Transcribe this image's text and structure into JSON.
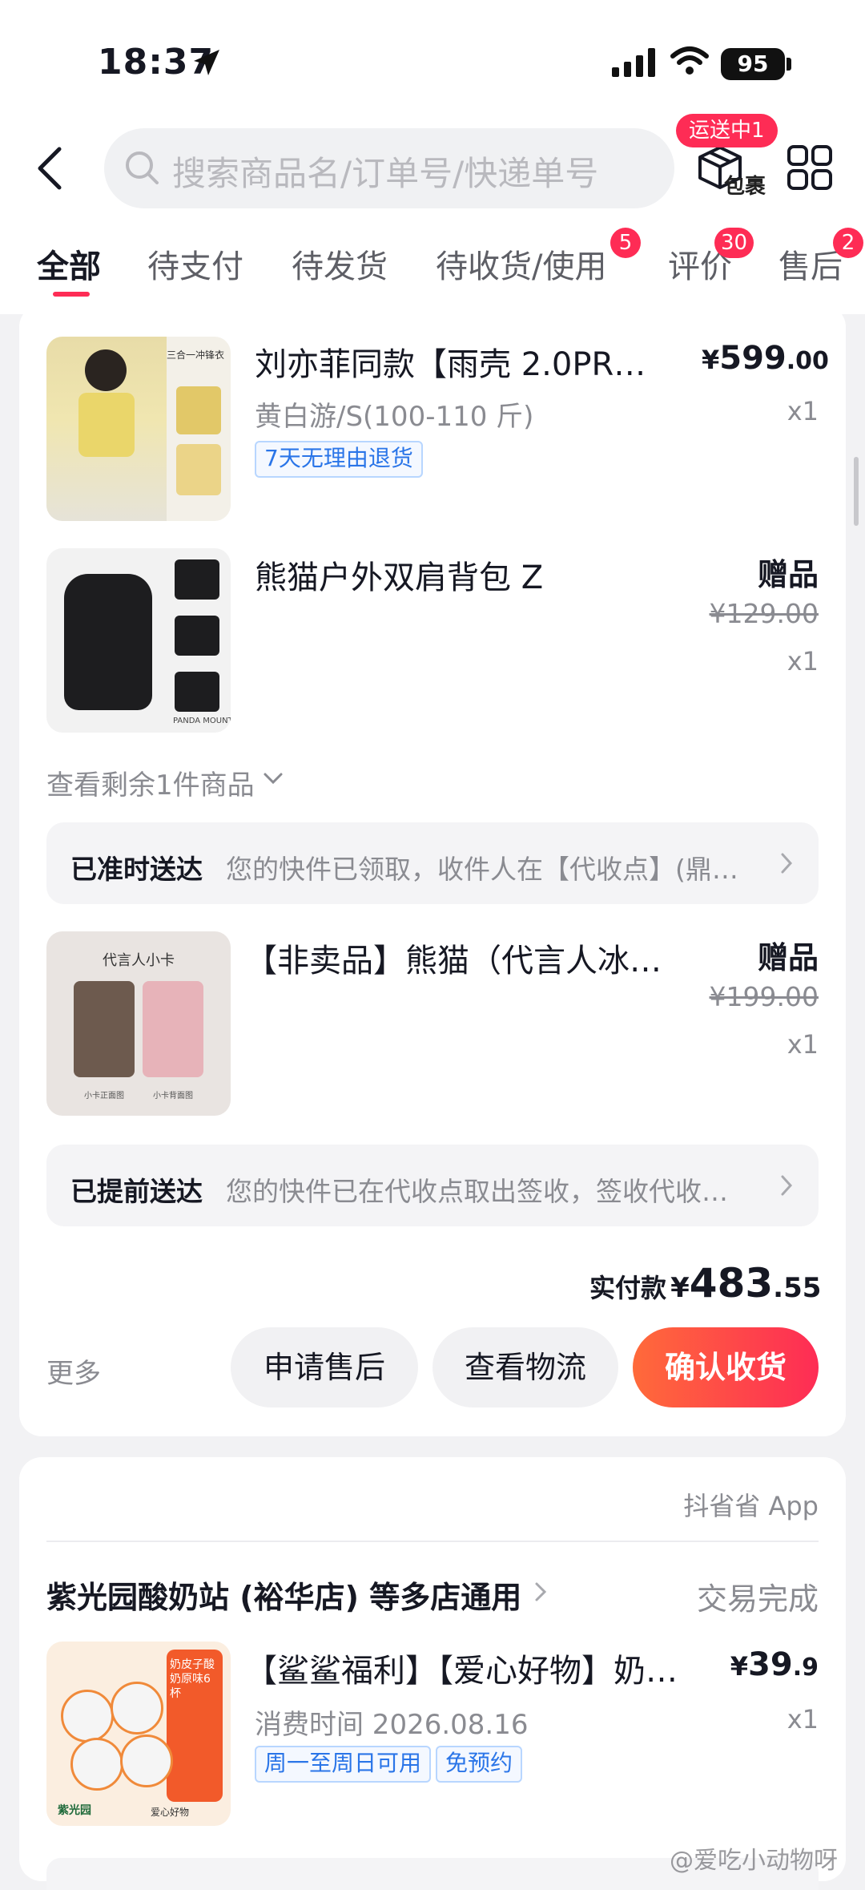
{
  "status_bar": {
    "time": "18:37",
    "battery": "95"
  },
  "header": {
    "search_placeholder": "搜索商品名/订单号/快递单号",
    "shipping_badge": "运送中1",
    "package_label": "包裹"
  },
  "tabs": [
    {
      "label": "全部",
      "active": true,
      "count": ""
    },
    {
      "label": "待支付",
      "count": ""
    },
    {
      "label": "待发货",
      "count": ""
    },
    {
      "label": "待收货/使用",
      "count": "5"
    },
    {
      "label": "评价",
      "count": "30"
    },
    {
      "label": "售后",
      "count": "2"
    }
  ],
  "order1": {
    "items": [
      {
        "title": "刘亦菲同款【雨壳 2.0PR…",
        "variant": "黄白游/S(100-110 斤)",
        "tag": "7天无理由退货",
        "price_symbol": "¥",
        "price_int": "599",
        "price_dec": ".00",
        "qty": "x1",
        "img_text": "三合一冲锋衣"
      },
      {
        "title": "熊猫户外双肩背包 Z",
        "gift_label": "赠品",
        "orig_price": "¥129.00",
        "qty": "x1",
        "img_text": "PANDA MOUNT"
      }
    ],
    "view_more": "查看剩余1件商品",
    "delivery1": {
      "status": "已准时送达",
      "text": "您的快件已领取，收件人在【代收点】(鼎…"
    },
    "item3": {
      "title": "【非卖品】熊猫（代言人冰…",
      "gift_label": "赠品",
      "orig_price": "¥199.00",
      "qty": "x1",
      "img_title": "代言人小卡",
      "img_cap1": "小卡正面图",
      "img_cap2": "小卡背面图"
    },
    "delivery2": {
      "status": "已提前送达",
      "text": "您的快件已在代收点取出签收，签收代收…"
    },
    "paid_label": "实付款",
    "paid_symbol": "¥",
    "paid_int": "483",
    "paid_dec": ".55",
    "more": "更多",
    "btn_aftersale": "申请售后",
    "btn_logistics": "查看物流",
    "btn_confirm": "确认收货"
  },
  "order2": {
    "source": "抖省省 App",
    "store": "紫光园酸奶站 (裕华店) 等多店通用",
    "status": "交易完成",
    "title": "【鲨鲨福利】【爱心好物】奶…",
    "price_symbol": "¥",
    "price_int": "39",
    "price_dec": ".9",
    "qty": "x1",
    "consume_time": "消费时间 2026.08.16",
    "tags": [
      "周一至周日可用",
      "免预约"
    ],
    "img_text": "奶皮子酸奶原味6杯",
    "img_brand": "紫光园",
    "img_badge": "爱心好物"
  },
  "watermark": "@爱吃小动物呀",
  "colors": {
    "accent": "#fe2c55",
    "tag_blue": "#2a75e8",
    "gray_text": "#8a8b91"
  }
}
